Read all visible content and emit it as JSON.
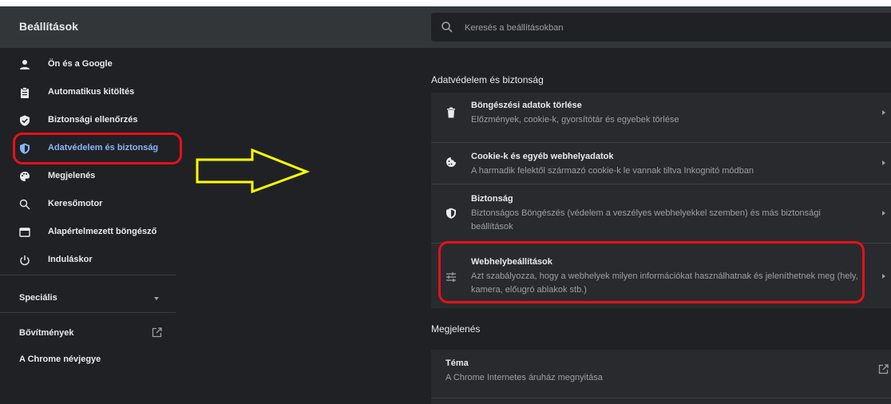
{
  "header": {
    "title": "Beállítások",
    "search_placeholder": "Keresés a beállításokban"
  },
  "sidebar": {
    "items": [
      {
        "label": "Ön és a Google",
        "icon": "person-icon"
      },
      {
        "label": "Automatikus kitöltés",
        "icon": "clipboard-icon"
      },
      {
        "label": "Biztonsági ellenőrzés",
        "icon": "shield-check-icon"
      },
      {
        "label": "Adatvédelem és biztonság",
        "icon": "shield-icon",
        "active": true
      },
      {
        "label": "Megjelenés",
        "icon": "palette-icon"
      },
      {
        "label": "Keresőmotor",
        "icon": "search-icon"
      },
      {
        "label": "Alapértelmezett böngésző",
        "icon": "browser-icon"
      },
      {
        "label": "Induláskor",
        "icon": "power-icon"
      }
    ],
    "advanced": "Speciális",
    "extensions": "Bővítmények",
    "about": "A Chrome névjegye"
  },
  "main": {
    "privacy_section_title": "Adatvédelem és biztonság",
    "privacy_rows": [
      {
        "title": "Böngészési adatok törlése",
        "desc": "Előzmények, cookie-k, gyorsítótár és egyebek törlése",
        "icon": "trash-icon"
      },
      {
        "title": "Cookie-k és egyéb webhelyadatok",
        "desc": "A harmadik felektől származó cookie-k le vannak tiltva Inkognitó módban",
        "icon": "cookie-icon"
      },
      {
        "title": "Biztonság",
        "desc": "Biztonságos Böngészés (védelem a veszélyes webhelyekkel szemben) és más biztonsági beállítások",
        "icon": "shield-icon"
      },
      {
        "title": "Webhelybeállítások",
        "desc": "Azt szabályozza, hogy a webhelyek milyen információkat használhatnak és jeleníthetnek meg (hely, kamera, előugró ablakok stb.)",
        "icon": "sliders-icon"
      }
    ],
    "appearance_section_title": "Megjelenés",
    "appearance_rows": [
      {
        "title": "Téma",
        "desc": "A Chrome Internetes áruház megnyitása",
        "icon": "external-link-icon"
      }
    ]
  },
  "colors": {
    "background": "#202124",
    "topbar": "#323639",
    "card": "#292a2d",
    "accent": "#8ab4f8",
    "annotation_red": "#e8101a",
    "annotation_yellow": "#ffff00"
  }
}
